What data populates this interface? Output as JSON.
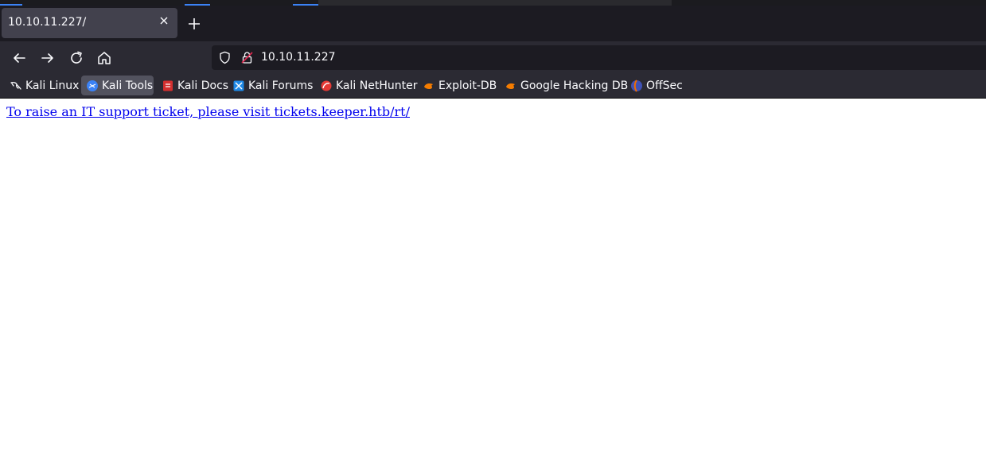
{
  "tabs": [
    {
      "title": "10.10.11.227/",
      "active": true
    }
  ],
  "address_bar": {
    "url": "10.10.11.227"
  },
  "bookmarks": [
    {
      "label": "Kali Linux",
      "icon": "kali-dragon-icon",
      "active": false
    },
    {
      "label": "Kali Tools",
      "icon": "kali-tools-icon",
      "active": true
    },
    {
      "label": "Kali Docs",
      "icon": "kali-docs-icon",
      "active": false
    },
    {
      "label": "Kali Forums",
      "icon": "kali-forums-icon",
      "active": false
    },
    {
      "label": "Kali NetHunter",
      "icon": "kali-nethunter-icon",
      "active": false
    },
    {
      "label": "Exploit-DB",
      "icon": "exploit-db-icon",
      "active": false
    },
    {
      "label": "Google Hacking DB",
      "icon": "ghdb-icon",
      "active": false
    },
    {
      "label": "OffSec",
      "icon": "offsec-icon",
      "active": false
    }
  ],
  "page": {
    "link_text": "To raise an IT support ticket, please visit tickets.keeper.htb/rt/"
  },
  "colors": {
    "tab_bar": "#1c1b22",
    "toolbar": "#2b2a33",
    "active_tab": "#42414d",
    "link": "#0000ee"
  }
}
